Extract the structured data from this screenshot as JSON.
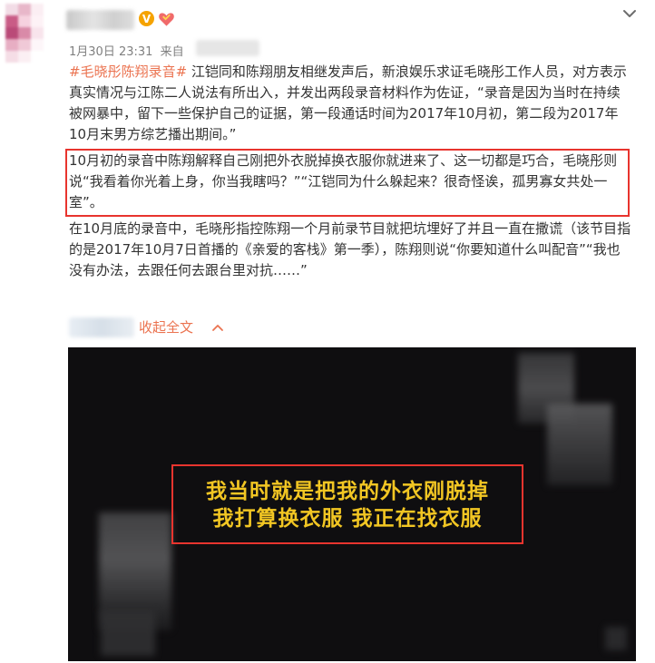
{
  "post": {
    "timestamp": "1月30日 23:31",
    "source_prefix": "来自",
    "hashtag": "#毛晓彤陈翔录音#",
    "paragraph1": "江铠同和陈翔朋友相继发声后，新浪娱乐求证毛晓彤工作人员，对方表示真实情况与江陈二人说法有所出入，并发出两段录音材料作为佐证，“录音是因为当时在持续被网暴中，留下一些保护自己的证据，第一段通话时间为2017年10月初，第二段为2017年10月末男方综艺播出期间。”",
    "highlighted_paragraph": "10月初的录音中陈翔解释自己刚把外衣脱掉换衣服你就进来了、这一切都是巧合，毛晓彤则说“我看着你光着上身，你当我瞎吗？”“江铠同为什么躲起来？很奇怪诶，孤男寡女共处一室”。",
    "paragraph3": "在10月底的录音中，毛晓彤指控陈翔一个月前录节目就把坑埋好了并且一直在撒谎（该节目指的是2017年10月7日首播的《亲爱的客栈》第一季），陈翔则说“你要知道什么叫配音”“我也没有办法，去跟任何去跟台里对抗……”",
    "collapse_label": "收起全文"
  },
  "header": {
    "verified_badge_text": "V",
    "icons": [
      "verified-icon",
      "club-icon",
      "chevron-down-icon"
    ]
  },
  "video": {
    "subtitle_line1": "我当时就是把我的外衣刚脱掉",
    "subtitle_line2": "我打算换衣服 我正在找衣服"
  },
  "colors": {
    "hashtag": "#eb7350",
    "highlight_border": "#e8342e",
    "subtitle": "#f2c623",
    "video_bg": "#0f0e10"
  }
}
